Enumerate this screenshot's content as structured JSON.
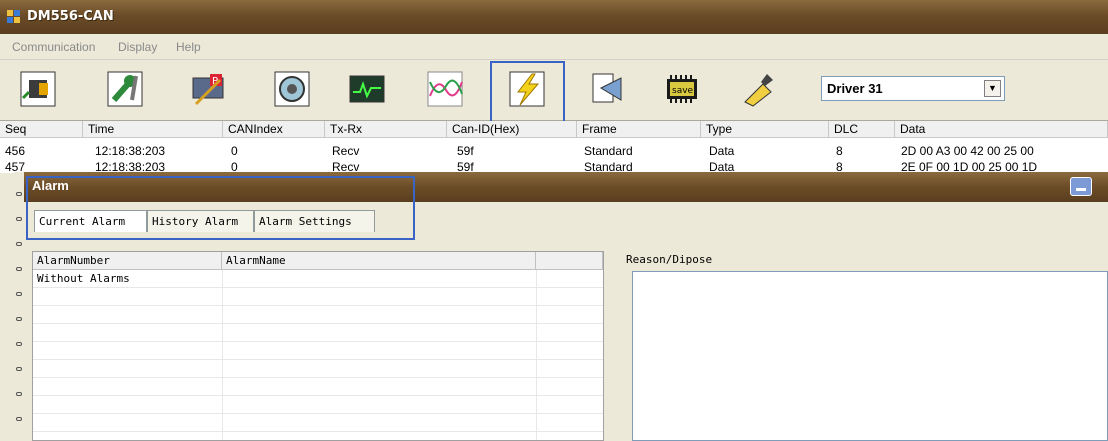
{
  "window": {
    "title": "DM556-CAN"
  },
  "menu": [
    "Communication",
    "Display",
    "Help"
  ],
  "toolbar": {
    "buttons": [
      {
        "name": "connect-icon"
      },
      {
        "name": "tools-icon"
      },
      {
        "name": "parameter-icon"
      },
      {
        "name": "target-icon"
      },
      {
        "name": "oscilloscope-icon"
      },
      {
        "name": "waveform-icon"
      },
      {
        "name": "lightning-icon"
      },
      {
        "name": "download-icon"
      },
      {
        "name": "save-chip-icon",
        "label": "save"
      },
      {
        "name": "clear-brush-icon"
      }
    ],
    "driver_select": "Driver 31"
  },
  "grid": {
    "headers": [
      "Seq",
      "Time",
      "CANIndex",
      "Tx-Rx",
      "Can-ID(Hex)",
      "Frame",
      "Type",
      "DLC",
      "Data"
    ],
    "rows": [
      [
        "456",
        "12:18:38:203",
        "0",
        "Recv",
        "59f",
        "Standard",
        "Data",
        "8",
        "2D 00 A3 00 42 00 25 00"
      ],
      [
        "457",
        "12:18:38:203",
        "0",
        "Recv",
        "59f",
        "Standard",
        "Data",
        "8",
        "2E 0F 00 1D 00 25 00 1D"
      ]
    ]
  },
  "alarm": {
    "title": "Alarm",
    "tabs": [
      "Current Alarm",
      "History Alarm",
      "Alarm Settings"
    ],
    "list_headers": [
      "AlarmNumber",
      "AlarmName",
      ""
    ],
    "list_rows": [
      [
        "Without Alarms",
        "",
        ""
      ]
    ],
    "reason_label": "Reason/Dipose"
  }
}
